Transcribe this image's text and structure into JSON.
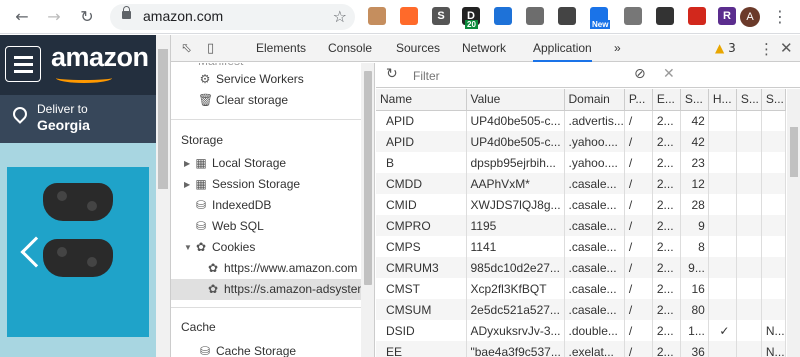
{
  "browser": {
    "url": "amazon.com",
    "back_icon": "back-arrow-icon",
    "forward_icon": "forward-arrow-icon",
    "reload_icon": "reload-icon",
    "extensions": [
      {
        "name": "ext-1",
        "color": "#c58e5e",
        "label": ""
      },
      {
        "name": "ext-2",
        "color": "#ff6a2a",
        "label": ""
      },
      {
        "name": "ext-3",
        "color": "#555555",
        "label": "S"
      },
      {
        "name": "ext-4",
        "color": "#222222",
        "label": "D",
        "badge": "20"
      },
      {
        "name": "ext-5",
        "color": "#1e72d8",
        "label": ""
      },
      {
        "name": "ext-6",
        "color": "#6d6d6d",
        "label": ""
      },
      {
        "name": "ext-7",
        "color": "#444444",
        "label": ""
      },
      {
        "name": "ext-8",
        "color": "#1a73e8",
        "label": "",
        "badge": "New"
      },
      {
        "name": "ext-9",
        "color": "#777777",
        "label": ""
      },
      {
        "name": "ext-10",
        "color": "#333333",
        "label": ""
      },
      {
        "name": "ext-11",
        "color": "#d2281c",
        "label": ""
      },
      {
        "name": "ext-12",
        "color": "#5b2d8e",
        "label": "R"
      }
    ],
    "avatar": "A"
  },
  "page": {
    "logo": "amazon",
    "deliver_label": "Deliver to",
    "deliver_location": "Georgia"
  },
  "devtools": {
    "tabs": [
      "Elements",
      "Console",
      "Sources",
      "Network",
      "Application"
    ],
    "active_tab": "Application",
    "more": "»",
    "warnings": "3",
    "sidebar": {
      "partial_top": "Manifest",
      "items_top": [
        {
          "icon": "gear-icon",
          "label": "Service Workers"
        },
        {
          "icon": "trash-icon",
          "label": "Clear storage"
        }
      ],
      "storage_header": "Storage",
      "storage_items": [
        {
          "label": "Local Storage"
        },
        {
          "label": "Session Storage"
        },
        {
          "label": "IndexedDB"
        },
        {
          "label": "Web SQL"
        },
        {
          "label": "Cookies"
        }
      ],
      "cookie_origins": [
        "https://www.amazon.com",
        "https://s.amazon-adsystem.com"
      ],
      "cache_header": "Cache",
      "cache_partial": "Cache Storage"
    },
    "filter_placeholder": "Filter",
    "columns": [
      "Name",
      "Value",
      "Domain",
      "P...",
      "E...",
      "S...",
      "H...",
      "S...",
      "S..."
    ],
    "rows": [
      {
        "name": "APID",
        "value": "UP4d0be505-c...",
        "domain": ".advertis...",
        "path": "/",
        "expires": "2...",
        "size": "42",
        "http": "",
        "secure": "",
        "same": ""
      },
      {
        "name": "APID",
        "value": "UP4d0be505-c...",
        "domain": ".yahoo....",
        "path": "/",
        "expires": "2...",
        "size": "42",
        "http": "",
        "secure": "",
        "same": ""
      },
      {
        "name": "B",
        "value": "dpspb95ejrbih...",
        "domain": ".yahoo....",
        "path": "/",
        "expires": "2...",
        "size": "23",
        "http": "",
        "secure": "",
        "same": ""
      },
      {
        "name": "CMDD",
        "value": "AAPhVxM*",
        "domain": ".casale...",
        "path": "/",
        "expires": "2...",
        "size": "12",
        "http": "",
        "secure": "",
        "same": ""
      },
      {
        "name": "CMID",
        "value": "XWJDS7lQJ8g...",
        "domain": ".casale...",
        "path": "/",
        "expires": "2...",
        "size": "28",
        "http": "",
        "secure": "",
        "same": ""
      },
      {
        "name": "CMPRO",
        "value": "1195",
        "domain": ".casale...",
        "path": "/",
        "expires": "2...",
        "size": "9",
        "http": "",
        "secure": "",
        "same": ""
      },
      {
        "name": "CMPS",
        "value": "1141",
        "domain": ".casale...",
        "path": "/",
        "expires": "2...",
        "size": "8",
        "http": "",
        "secure": "",
        "same": ""
      },
      {
        "name": "CMRUM3",
        "value": "985dc10d2e27...",
        "domain": ".casale...",
        "path": "/",
        "expires": "2...",
        "size": "9...",
        "http": "",
        "secure": "",
        "same": ""
      },
      {
        "name": "CMST",
        "value": "Xcp2fl3KfBQT",
        "domain": ".casale...",
        "path": "/",
        "expires": "2...",
        "size": "16",
        "http": "",
        "secure": "",
        "same": ""
      },
      {
        "name": "CMSUM",
        "value": "2e5dc521a527...",
        "domain": ".casale...",
        "path": "/",
        "expires": "2...",
        "size": "80",
        "http": "",
        "secure": "",
        "same": ""
      },
      {
        "name": "DSID",
        "value": "ADyxuksrvJv-3...",
        "domain": ".double...",
        "path": "/",
        "expires": "2...",
        "size": "1...",
        "http": "✓",
        "secure": "",
        "same": "N..."
      },
      {
        "name": "EE",
        "value": "\"bae4a3f9c537...",
        "domain": ".exelat...",
        "path": "/",
        "expires": "2...",
        "size": "36",
        "http": "",
        "secure": "",
        "same": "N..."
      }
    ]
  }
}
